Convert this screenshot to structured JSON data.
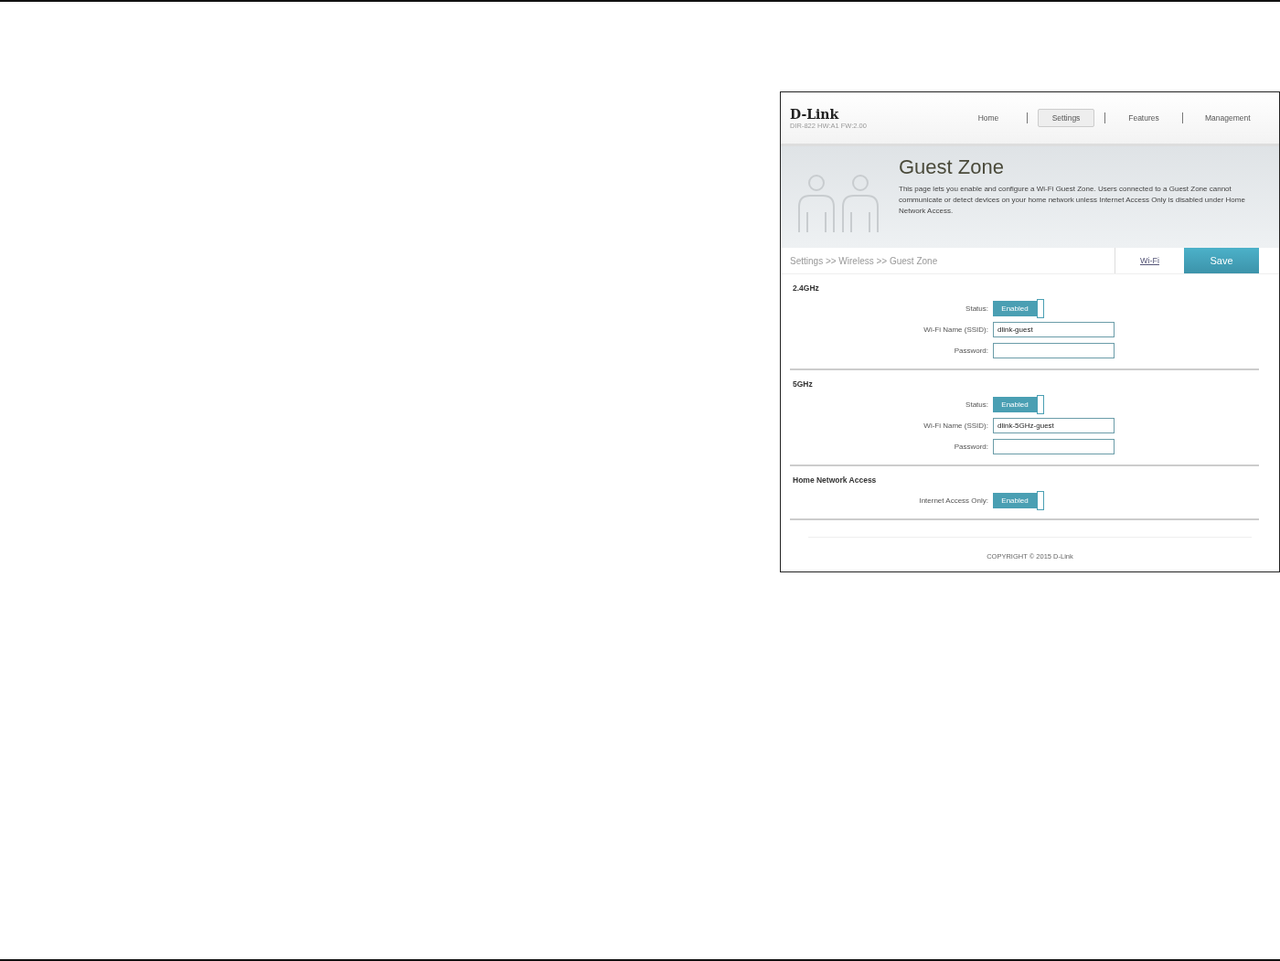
{
  "header": {
    "logo": "D-Link",
    "model": "DIR-822 HW:A1 FW:2.00",
    "nav": [
      {
        "label": "Home",
        "selected": false
      },
      {
        "label": "Settings",
        "selected": true
      },
      {
        "label": "Features",
        "selected": false
      },
      {
        "label": "Management",
        "selected": false
      }
    ]
  },
  "banner": {
    "title": "Guest Zone",
    "description": "This page lets you enable and configure a Wi-Fi Guest Zone. Users connected to a Guest Zone cannot communicate or detect devices on your home network unless Internet Access Only is disabled under Home Network Access."
  },
  "breadcrumb": "Settings >> Wireless >> Guest Zone",
  "link": "Wi-Fi",
  "save": "Save",
  "sections": [
    {
      "title": "2.4GHz",
      "rows": [
        {
          "kind": "toggle",
          "label": "Status:",
          "on": true,
          "text": "Enabled"
        },
        {
          "kind": "input",
          "label": "Wi-Fi Name (SSID):",
          "value": "dlink-guest"
        },
        {
          "kind": "input",
          "label": "Password:"
        }
      ]
    },
    {
      "title": "5GHz",
      "rows": [
        {
          "kind": "toggle",
          "label": "Status:",
          "on": true,
          "text": "Enabled"
        },
        {
          "kind": "input",
          "label": "Wi-Fi Name (SSID):",
          "value": "dlink-5GHz-guest"
        },
        {
          "kind": "input",
          "label": "Password:"
        }
      ]
    },
    {
      "title": "Home Network Access",
      "rows": [
        {
          "kind": "toggle",
          "label": "Internet Access Only:",
          "on": true,
          "text": "Enabled"
        }
      ]
    }
  ],
  "footer": "COPYRIGHT © 2015 D-Link"
}
